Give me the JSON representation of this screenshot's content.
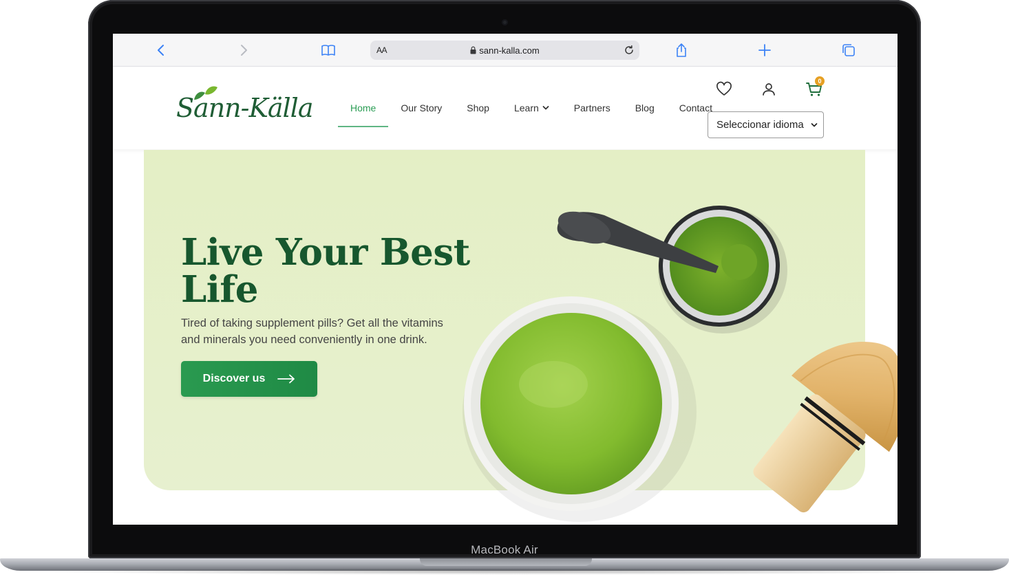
{
  "device": {
    "label": "MacBook Air"
  },
  "browser": {
    "address": {
      "aa_label": "AA",
      "url": "sann-kalla.com"
    },
    "icons": [
      "back-icon",
      "forward-icon",
      "bookmarks-icon",
      "lock-icon",
      "reload-icon",
      "share-icon",
      "new-tab-icon",
      "tabs-icon"
    ]
  },
  "site": {
    "logo_text": "Sann-Källa",
    "nav": [
      {
        "label": "Home",
        "active": true
      },
      {
        "label": "Our Story"
      },
      {
        "label": "Shop"
      },
      {
        "label": "Learn",
        "has_dropdown": true
      },
      {
        "label": "Partners"
      },
      {
        "label": "Blog"
      },
      {
        "label": "Contact"
      }
    ],
    "header_icons": [
      "heart-icon",
      "user-icon",
      "cart-icon"
    ],
    "cart_count": "0",
    "language_select": {
      "value": "Seleccionar idioma"
    }
  },
  "hero": {
    "title": "Live Your Best Life",
    "subtitle": "Tired of taking supplement pills? Get all the vitamins and minerals you need conveniently in one drink.",
    "cta_label": "Discover us"
  },
  "colors": {
    "brand_green": "#17572e",
    "accent_green": "#2a9d54",
    "hero_bg": "#e4efc5",
    "badge": "#e6a024",
    "matcha": "#8dc23a"
  }
}
